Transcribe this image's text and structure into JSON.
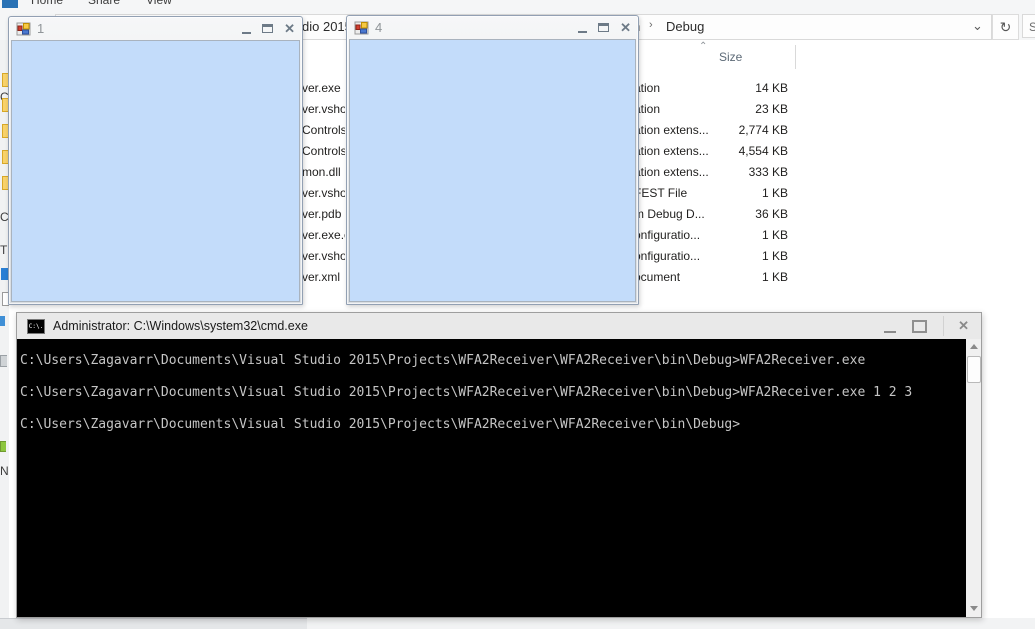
{
  "explorer": {
    "ribbon_tabs": [
      "Home",
      "Share",
      "View"
    ],
    "address": {
      "fragment_left": "dio 2015",
      "fragment_mid": "n",
      "separator": "›",
      "crumb": "Debug",
      "chevron_icon": "⌄",
      "refresh_icon": "↻",
      "search_fragment": "S"
    },
    "header": {
      "size_label": "Size",
      "sort_icon": "⌃"
    },
    "files": [
      {
        "name": "ver.exe",
        "type": "ation",
        "size": "14 KB"
      },
      {
        "name": "ver.vshos",
        "type": "ation",
        "size": "23 KB"
      },
      {
        "name": "Controls",
        "type": "ation extens...",
        "size": "2,774 KB"
      },
      {
        "name": "Controls",
        "type": "ation extens...",
        "size": "4,554 KB"
      },
      {
        "name": "mon.dll",
        "type": "ation extens...",
        "size": "333 KB"
      },
      {
        "name": "ver.vshos",
        "type": "FEST File",
        "size": "1 KB"
      },
      {
        "name": "ver.pdb",
        "type": "m Debug D...",
        "size": "36 KB"
      },
      {
        "name": "ver.exe.c",
        "type": "onfiguratio...",
        "size": "1 KB"
      },
      {
        "name": "ver.vshos",
        "type": "onfiguratio...",
        "size": "1 KB"
      },
      {
        "name": "ver.xml",
        "type": "ocument",
        "size": "1 KB"
      }
    ],
    "nav_letters": [
      "C",
      "C",
      "T",
      "N"
    ]
  },
  "forms": {
    "form1_title": "1",
    "form4_title": "4",
    "minimize_label": "minimize",
    "maximize_label": "maximize",
    "close_label": "✕"
  },
  "cmd": {
    "title": "Administrator: C:\\Windows\\system32\\cmd.exe",
    "icon_label": "C:\\.",
    "close_label": "✕",
    "lines": [
      "C:\\Users\\Zagavarr\\Documents\\Visual Studio 2015\\Projects\\WFA2Receiver\\WFA2Receiver\\bin\\Debug>WFA2Receiver.exe",
      "C:\\Users\\Zagavarr\\Documents\\Visual Studio 2015\\Projects\\WFA2Receiver\\WFA2Receiver\\bin\\Debug>WFA2Receiver.exe 1 2 3",
      "C:\\Users\\Zagavarr\\Documents\\Visual Studio 2015\\Projects\\WFA2Receiver\\WFA2Receiver\\bin\\Debug>"
    ]
  },
  "colors": {
    "form_body_blue": "#c3dcfa",
    "file_tab_blue": "#2a72b5",
    "console_bg": "#000000",
    "console_text": "#c5c5c5"
  }
}
